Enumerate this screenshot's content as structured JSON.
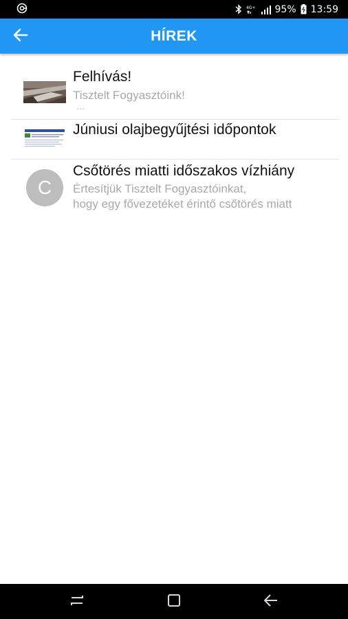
{
  "status_bar": {
    "battery_percent": "95%",
    "time": "13:59",
    "network": "4G+",
    "icons": [
      "app-notification-icon",
      "bluetooth-icon",
      "network-icon",
      "signal-icon",
      "battery-icon"
    ]
  },
  "app_bar": {
    "title": "HÍREK",
    "back_icon": "arrow-left-icon",
    "color": "#2196f3"
  },
  "news": [
    {
      "title": "Felhívás!",
      "description": "Tisztelt Fogyasztóink!",
      "more": "...",
      "thumbnail": "photo-thumbnail"
    },
    {
      "title": "Júniusi olajbegyűjtési időpontok",
      "thumbnail": "document-thumbnail"
    },
    {
      "title": "Csőtörés miatti időszakos vízhiány",
      "description_lines": [
        "Értesítjük Tisztelt Fogyasztóinkat,",
        "hogy egy fővezetéket érintő csőtörés miatt"
      ],
      "avatar_letter": "C"
    }
  ],
  "nav_bar": {
    "icons": [
      "recent-apps-icon",
      "home-icon",
      "back-icon"
    ]
  }
}
